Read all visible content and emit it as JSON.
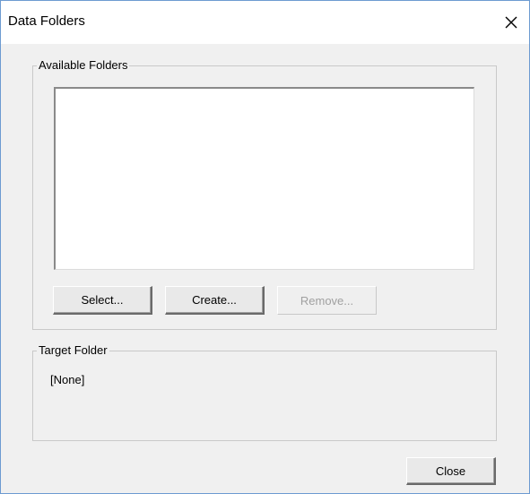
{
  "window": {
    "title": "Data Folders",
    "close_glyph": "✕"
  },
  "available_folders": {
    "legend": "Available Folders",
    "items": [],
    "buttons": {
      "select_label": "Select...",
      "create_label": "Create...",
      "remove_label": "Remove...",
      "remove_enabled": false
    }
  },
  "target_folder": {
    "legend": "Target Folder",
    "value": "[None]"
  },
  "footer": {
    "close_label": "Close"
  },
  "icons": {
    "window_close": "close-icon"
  },
  "colors": {
    "window_border": "#6d9bd1",
    "dialog_background": "#f0f0f0",
    "titlebar_background": "#ffffff",
    "disabled_text": "#a0a0a0"
  }
}
